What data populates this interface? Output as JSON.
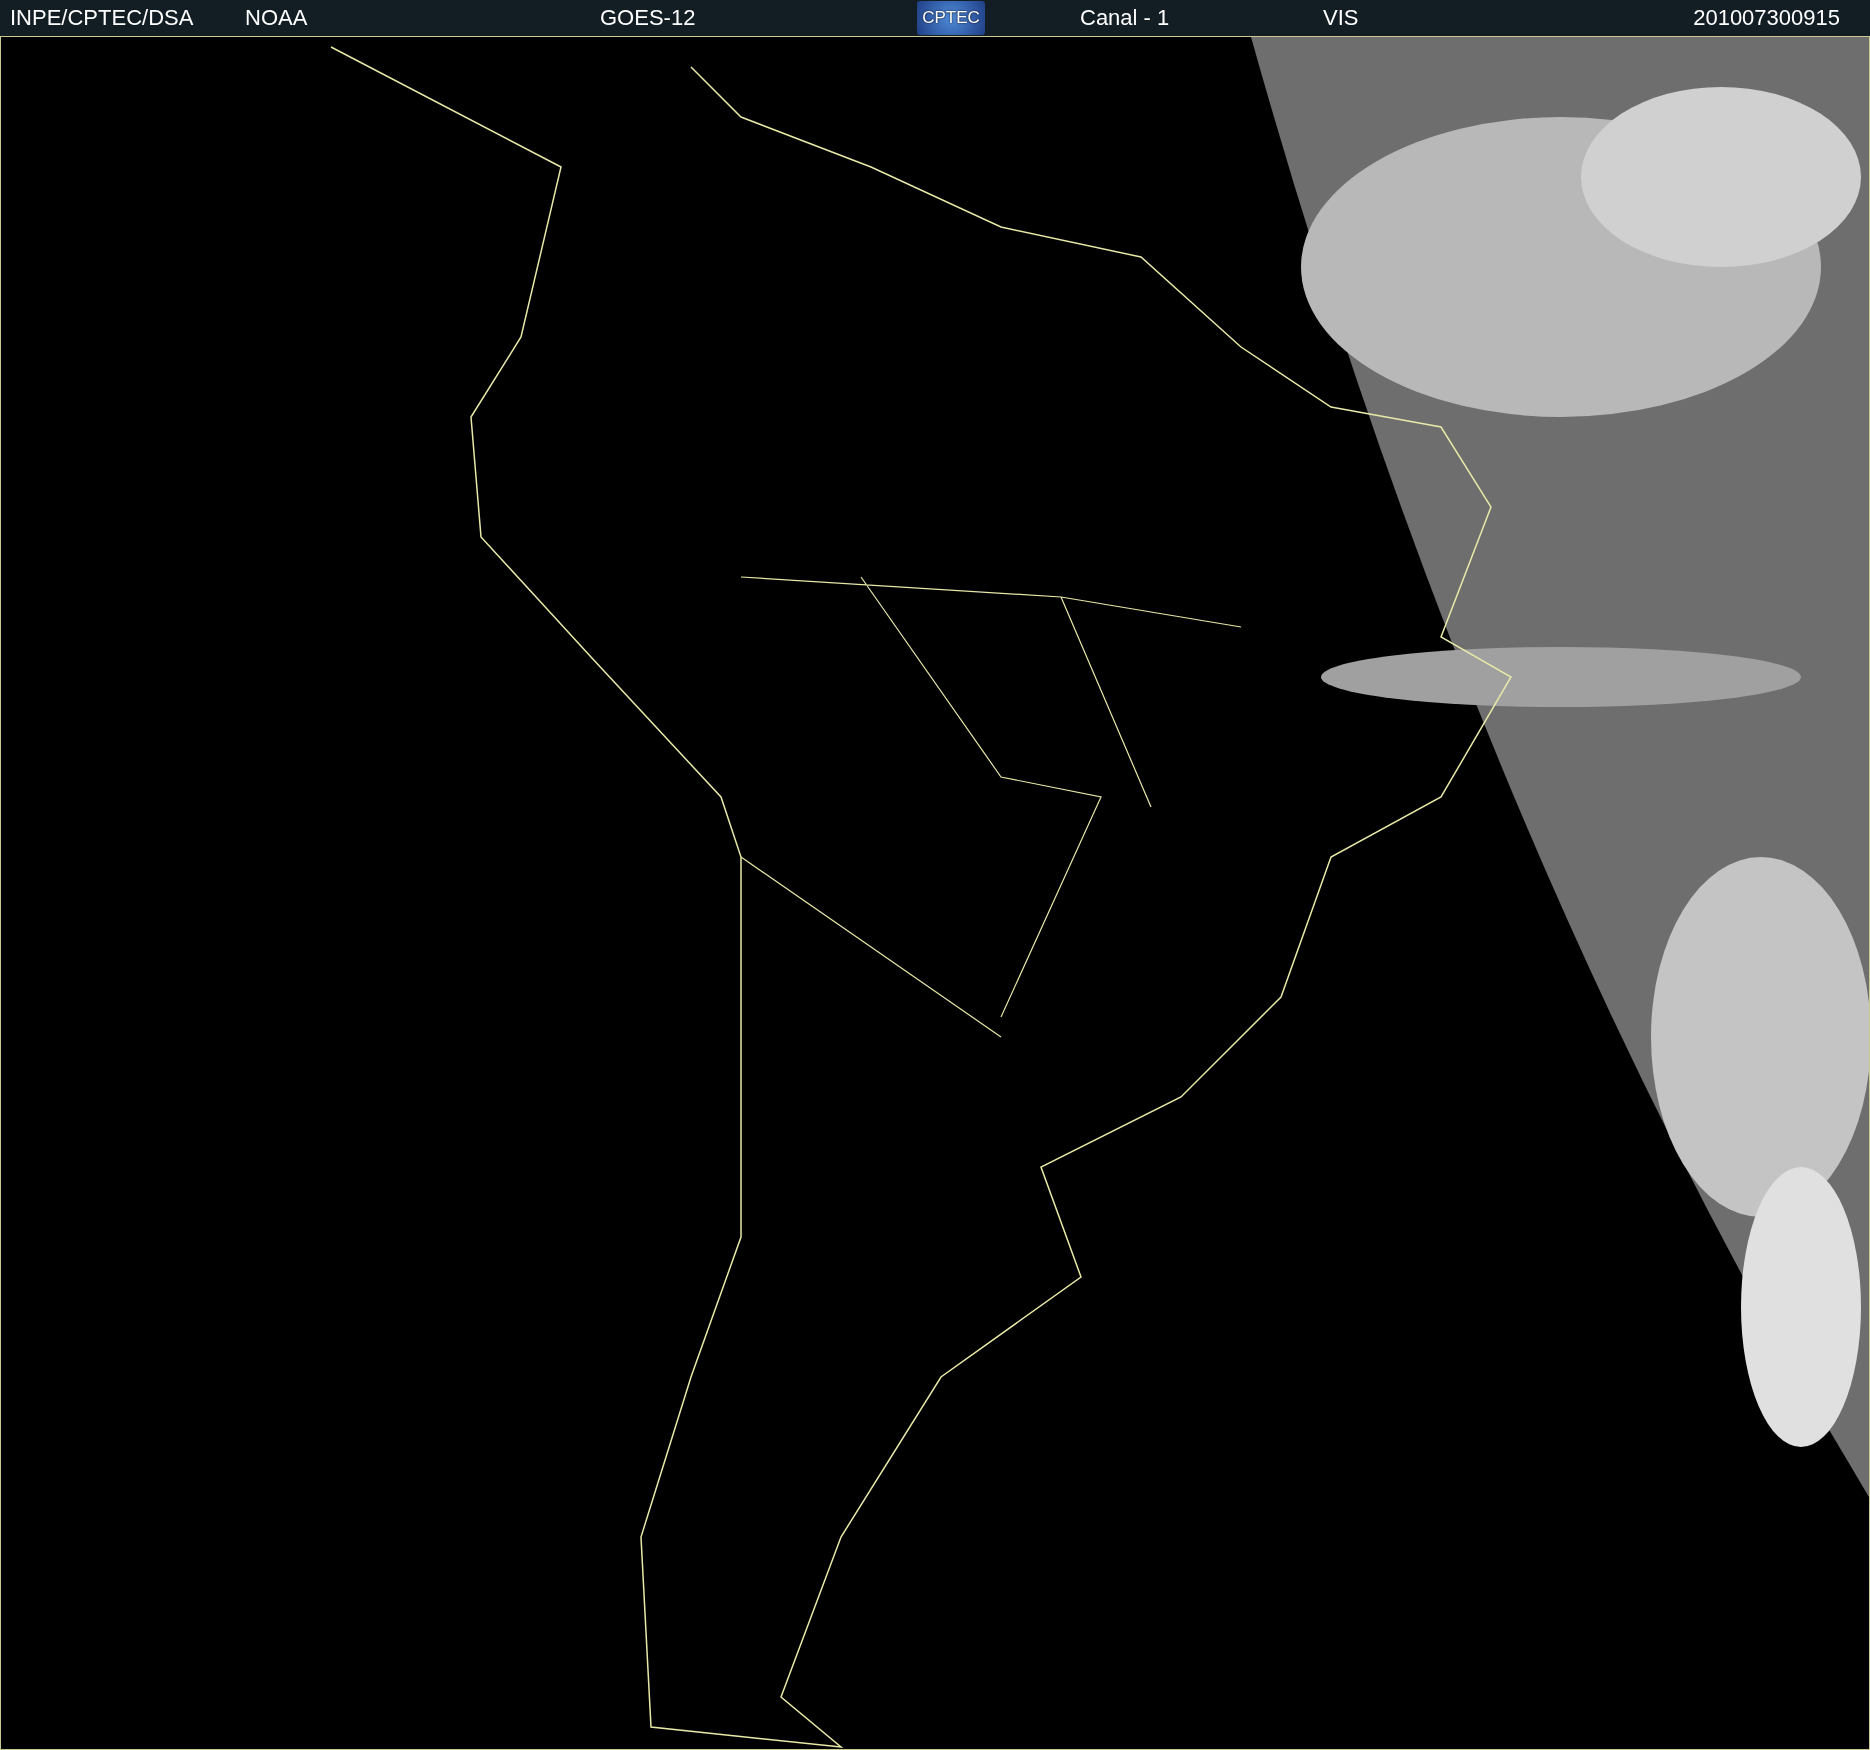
{
  "header": {
    "source": "INPE/CPTEC/DSA",
    "agency": "NOAA",
    "satellite": "GOES-12",
    "logo": "CPTEC",
    "channel": "Canal - 1",
    "band": "VIS",
    "timestamp": "201007300915"
  }
}
